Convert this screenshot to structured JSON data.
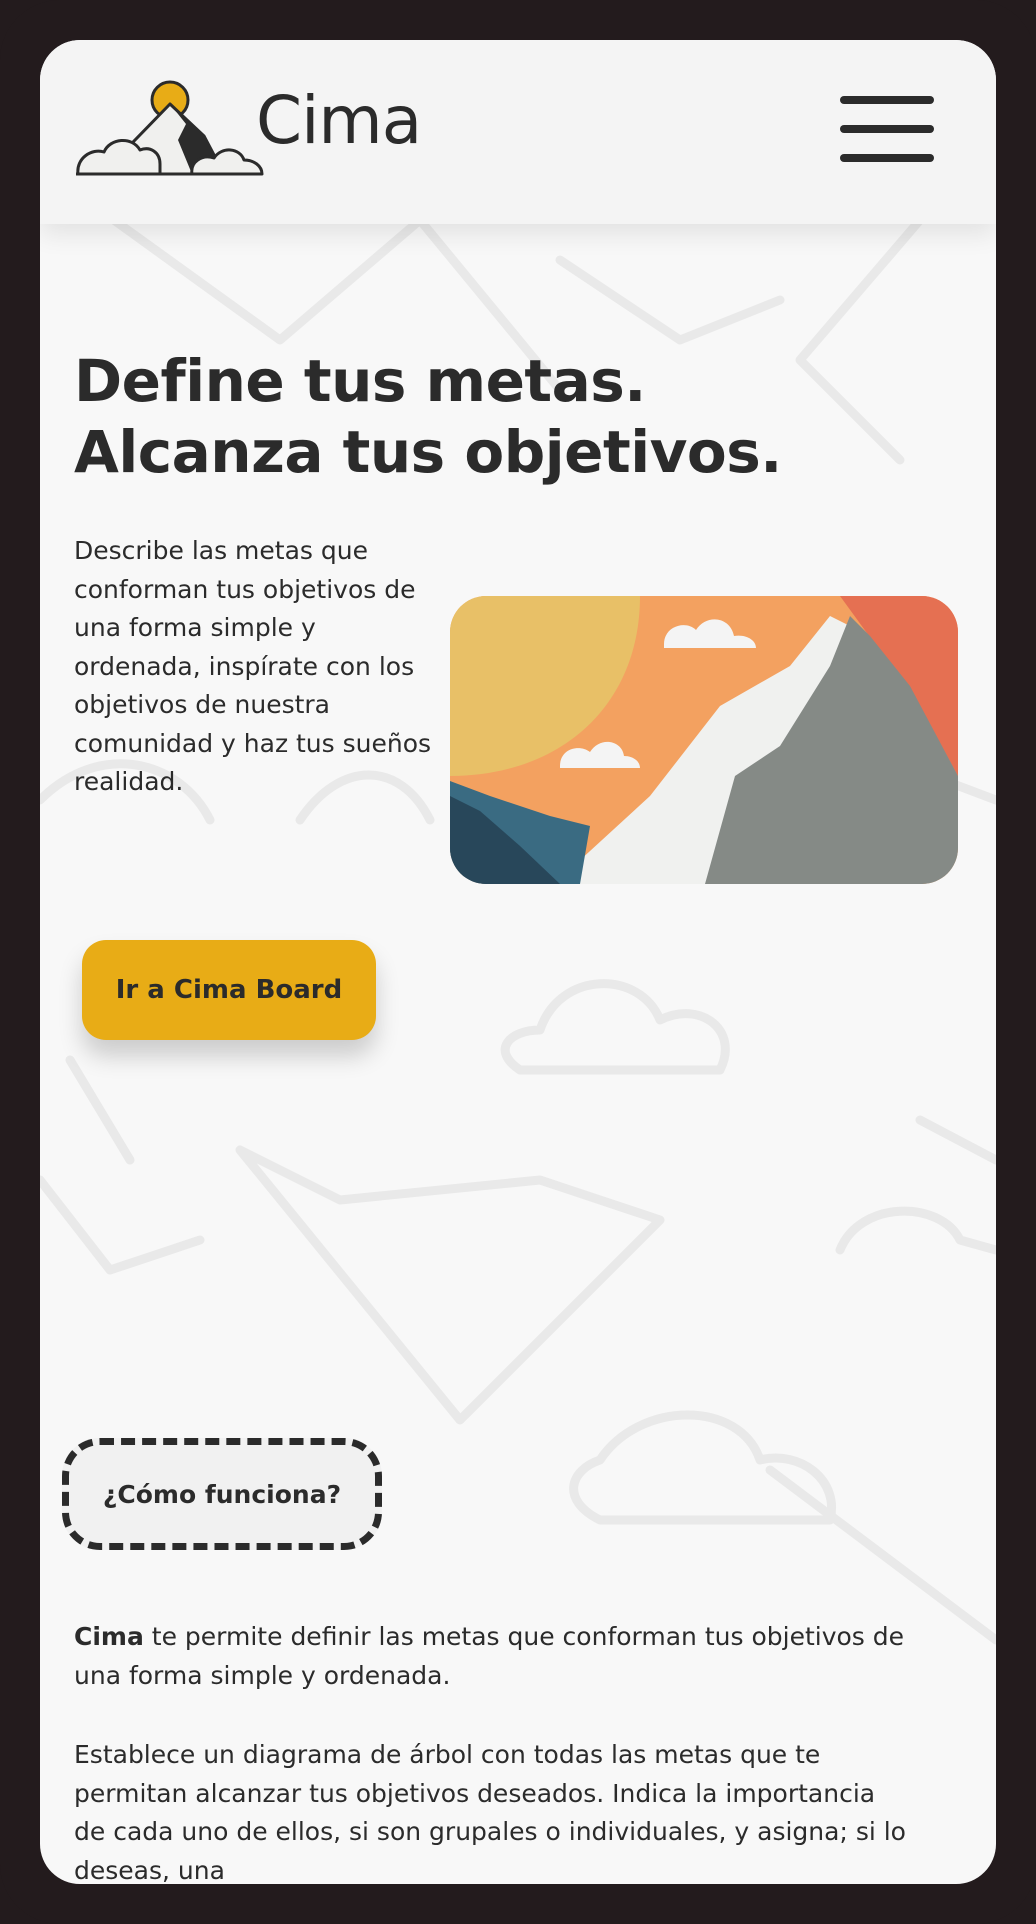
{
  "header": {
    "brand": "Cima",
    "menu_icon": "hamburger-menu-icon",
    "logo_icon": "mountain-sun-cloud-logo"
  },
  "hero": {
    "title_line1": "Define tus metas.",
    "title_line2": "Alcanza tus objetivos.",
    "description": "Describe las metas que conforman tus objetivos de una forma simple y ordenada, inspírate con los objetivos de nuestra comunidad y haz tus sueños realidad.",
    "illustration_icon": "mountain-landscape-illustration",
    "cta_label": "Ir a Cima Board"
  },
  "how_it_works": {
    "badge": "¿Cómo funciona?",
    "p1_strong": "Cima",
    "p1_rest": " te permite definir las metas que conforman tus objetivos de una forma simple y ordenada.",
    "p2": "Establece un diagrama de árbol con todas las metas que te permitan alcanzar tus objetivos deseados. Indica la importancia de cada uno de ellos, si son grupales o individuales, y asigna; si lo deseas, una"
  },
  "colors": {
    "accent": "#e8ac16",
    "text": "#2b2b2b",
    "frame": "#231b1d",
    "screen_bg": "#f8f8f8"
  }
}
